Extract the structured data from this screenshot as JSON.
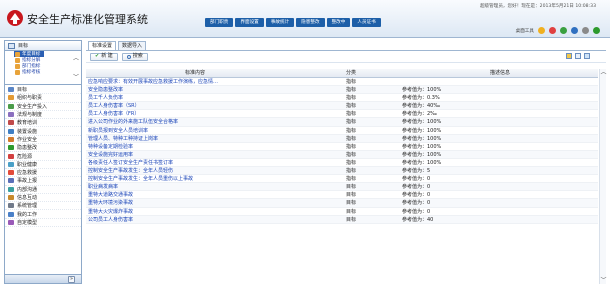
{
  "header": {
    "title": "安全生产标准化管理系统",
    "user_info": "超级管理员，您好！现在是：2013年5月21日 10:08:33",
    "tabs": [
      "部门职责",
      "界面设置",
      "事故统计",
      "隐患整改",
      "整改中",
      "人员证书"
    ],
    "tools_label": "桌面工具"
  },
  "sidebar": {
    "header": "目标",
    "sub_items": [
      "年度目标",
      "指标分解",
      "部门指标",
      "指标考核"
    ],
    "items": [
      "目标",
      "组织与职责",
      "安全生产投入",
      "法规与制度",
      "教育培训",
      "装置设施",
      "作业安全",
      "隐患整改",
      "危险源",
      "职业健康",
      "应急救援",
      "事故上报",
      "内部沟通",
      "信息互动",
      "系统管理",
      "我的工作",
      "自定模型"
    ]
  },
  "main": {
    "tabs": [
      "标准设置",
      "数据导入"
    ],
    "toolbar": {
      "new_label": "新 建",
      "search_label": "搜索"
    },
    "columns": [
      "标准内容",
      "分类",
      "描述信息"
    ],
    "rows": [
      {
        "content": "应急响应要求：有效开展事故应急救援工作演练，应急情…",
        "category": "指标",
        "desc": ""
      },
      {
        "content": "安全隐患整改率",
        "category": "指标",
        "desc": "参考值为：100%"
      },
      {
        "content": "员工千人负伤率",
        "category": "指标",
        "desc": "参考值为：0.3%"
      },
      {
        "content": "员工人身伤害率（SR）",
        "category": "指标",
        "desc": "参考值为：40‰"
      },
      {
        "content": "员工人身伤害率（FR）",
        "category": "指标",
        "desc": "参考值为：2‰"
      },
      {
        "content": "进入公司作业的外来施工队伍安全合格率",
        "category": "指标",
        "desc": "参考值为：100%"
      },
      {
        "content": "新职员报到安全人员培训率",
        "category": "指标",
        "desc": "参考值为：100%"
      },
      {
        "content": "管理人员、特种工种持证上岗率",
        "category": "指标",
        "desc": "参考值为：100%"
      },
      {
        "content": "特种设备定期检验率",
        "category": "指标",
        "desc": "参考值为：100%"
      },
      {
        "content": "安全设施完好运用率",
        "category": "指标",
        "desc": "参考值为：100%"
      },
      {
        "content": "各级责任人签订安全生产责任书签订率",
        "category": "指标",
        "desc": "参考值为：100%"
      },
      {
        "content": "控制安全生产事故发生：全年人员轻伤",
        "category": "指标",
        "desc": "参考值为：5"
      },
      {
        "content": "控制安全生产事故发生：全年人员重伤以上事故",
        "category": "指标",
        "desc": "参考值为：0"
      },
      {
        "content": "职业病发病率",
        "category": "目标",
        "desc": "参考值为：0"
      },
      {
        "content": "重特大道路交通事故",
        "category": "目标",
        "desc": "参考值为：0"
      },
      {
        "content": "重特大环境污染事故",
        "category": "目标",
        "desc": "参考值为：0"
      },
      {
        "content": "重特大火灾爆炸事故",
        "category": "目标",
        "desc": "参考值为：0"
      },
      {
        "content": "公司员工人身伤害率",
        "category": "目标",
        "desc": "参考值为：40"
      }
    ]
  },
  "colors": {
    "accent": "#1d5fa8",
    "link": "#1a44b8"
  }
}
